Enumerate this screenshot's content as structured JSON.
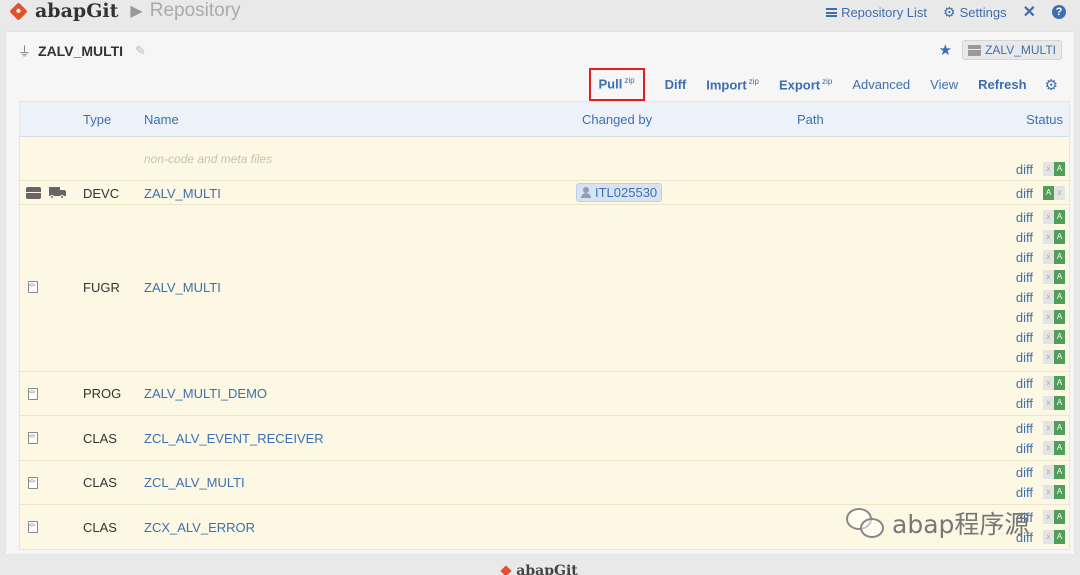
{
  "header": {
    "app_name": "abapGit",
    "breadcrumb": "Repository",
    "nav": {
      "repo_list": "Repository List",
      "settings": "Settings"
    }
  },
  "repo": {
    "name": "ZALV_MULTI",
    "package": "ZALV_MULTI"
  },
  "actions": {
    "pull": "Pull",
    "pull_sup": "zip",
    "diff": "Diff",
    "import": "Import",
    "import_sup": "zip",
    "export": "Export",
    "export_sup": "zip",
    "advanced": "Advanced",
    "view": "View",
    "refresh": "Refresh"
  },
  "table": {
    "columns": {
      "type": "Type",
      "name": "Name",
      "changed_by": "Changed by",
      "path": "Path",
      "status": "Status"
    },
    "meta_row": {
      "label": "non-code and meta files",
      "diff": "diff"
    },
    "rows": [
      {
        "type": "DEVC",
        "name": "ZALV_MULTI",
        "changed_by": "ITL025530",
        "diff": "diff"
      },
      {
        "type": "FUGR",
        "name": "ZALV_MULTI",
        "diff": "diff"
      },
      {
        "type": "PROG",
        "name": "ZALV_MULTI_DEMO",
        "diff": "diff"
      },
      {
        "type": "CLAS",
        "name": "ZCL_ALV_EVENT_RECEIVER",
        "diff": "diff"
      },
      {
        "type": "CLAS",
        "name": "ZCL_ALV_MULTI",
        "diff": "diff"
      },
      {
        "type": "CLAS",
        "name": "ZCX_ALV_ERROR",
        "diff": "diff"
      }
    ],
    "status_marks": {
      "added": "A",
      "none": "x"
    }
  },
  "footer": {
    "logo": "abapGit"
  },
  "watermark": {
    "text": "abap程序源"
  }
}
